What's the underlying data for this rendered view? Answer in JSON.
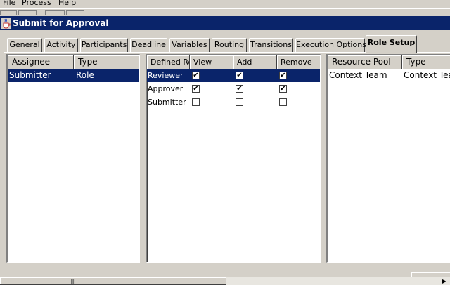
{
  "menu": [
    "File",
    "Process",
    "Help"
  ],
  "window": {
    "title": "Submit for Approval",
    "icon": "java-cup-icon"
  },
  "tabs": [
    {
      "label": "General",
      "active": false
    },
    {
      "label": "Activity",
      "active": false
    },
    {
      "label": "Participants",
      "active": false
    },
    {
      "label": "Deadline",
      "active": false
    },
    {
      "label": "Variables",
      "active": false
    },
    {
      "label": "Routing",
      "active": false
    },
    {
      "label": "Transitions",
      "active": false
    },
    {
      "label": "Execution Options",
      "active": false
    },
    {
      "label": "Role Setup",
      "active": true
    }
  ],
  "assignees": {
    "columns": [
      "Assignee",
      "Type"
    ],
    "rows": [
      {
        "assignee": "Submitter",
        "type": "Role",
        "selected": true
      }
    ]
  },
  "roles": {
    "columns": [
      "Defined Ro",
      "View",
      "Add",
      "Remove"
    ],
    "rows": [
      {
        "role": "Reviewer",
        "view": true,
        "add": true,
        "remove": true,
        "selected": true
      },
      {
        "role": "Approver",
        "view": true,
        "add": true,
        "remove": true,
        "selected": false
      },
      {
        "role": "Submitter",
        "view": false,
        "add": false,
        "remove": false,
        "selected": false
      }
    ]
  },
  "resources": {
    "columns": [
      "Resource Pool",
      "Type"
    ],
    "rows": [
      {
        "pool": "Context Team",
        "type": "Context Tea"
      }
    ]
  },
  "scrollbar": {
    "grip": "|||"
  },
  "check_glyph": "✔",
  "colors": {
    "selection": "#0a246a",
    "titlebar": "#0a246a",
    "face": "#d4d0c8"
  }
}
